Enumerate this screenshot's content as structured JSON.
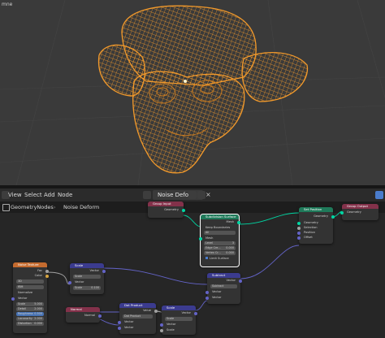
{
  "viewport": {
    "corner_label": "mne"
  },
  "header": {
    "menus": [
      "View",
      "Select",
      "Add",
      "Node"
    ],
    "tree_name": "Noise Deform"
  },
  "breadcrumb": {
    "items": [
      "GeometryNodes",
      "Noise Deform"
    ]
  },
  "nodes": {
    "group_input": {
      "title": "Group Input",
      "geometry": "Geometry"
    },
    "subdivision": {
      "title": "Subdivision Surface",
      "mesh_out": "Mesh",
      "keep_boundaries": "Keep Boundaries",
      "uvs": "All",
      "mesh_in": "Mesh",
      "level": "Level",
      "level_val": "3",
      "edge_crease": "Edge Cre...",
      "edge_val": "0.000",
      "vertex_crease": "Vertex Cr...",
      "vertex_val": "0.000",
      "limit_surface": "Limit Surface"
    },
    "set_position": {
      "title": "Set Position",
      "geometry_out": "Geometry",
      "geometry_in": "Geometry",
      "selection": "Selection",
      "position": "Position",
      "offset": "Offset"
    },
    "group_output": {
      "title": "Group Output",
      "geometry": "Geometry"
    },
    "noise_texture": {
      "title": "Noise Texture",
      "fac": "Fac",
      "color": "Color",
      "dim": "3D",
      "basis": "fBM",
      "normalize": "Normalize",
      "vector": "Vector",
      "scale": "Scale",
      "scale_val": "5.000",
      "detail": "Detail",
      "detail_val": "2.000",
      "roughness": "Roughness",
      "roughness_val": "0.500",
      "lacunarity": "Lacunarity",
      "lacunarity_val": "2.000",
      "distortion": "Distortion",
      "distortion_val": "0.000"
    },
    "scale": {
      "title": "Scale",
      "vector_out": "Vector",
      "mode": "Scale",
      "vector": "Vector",
      "scale": "Scale",
      "scale_val": "0.100"
    },
    "normal": {
      "title": "Normal",
      "normal_out": "Normal"
    },
    "dot_product": {
      "title": "Dot Product",
      "value": "Value",
      "mode": "Dot Product",
      "vector1": "Vector",
      "vector2": "Vector"
    },
    "scale2": {
      "title": "Scale",
      "vector_out": "Vector",
      "mode": "Scale",
      "vector": "Vector",
      "scale": "Scale"
    },
    "subtract": {
      "title": "Subtract",
      "vector_out": "Vector",
      "mode": "Subtract",
      "vector1": "Vector",
      "vector2": "Vector"
    }
  },
  "colors": {
    "geometry_header": "#1f7a5a",
    "vector_header": "#3b3b8f",
    "input_header": "#83314a",
    "texture_header": "#c46b2f",
    "wire": "#f39a2b",
    "socket_geometry": "#00d6a3",
    "socket_vector": "#6363c7"
  }
}
